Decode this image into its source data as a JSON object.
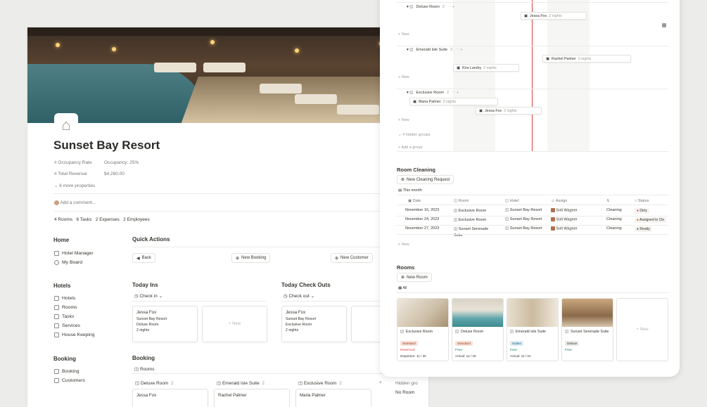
{
  "page": {
    "title": "Sunset Bay Resort",
    "icon": "house-flood-icon"
  },
  "properties": [
    {
      "label": "Occupancy Rate",
      "value": "Occupancy: 25%"
    },
    {
      "label": "Total Revenue",
      "value": "$4,280.00"
    }
  ],
  "more_properties": "6 more properties",
  "comment_placeholder": "Add a comment...",
  "relations": [
    "4 Rooms",
    "6 Tasks",
    "2 Expenses",
    "2 Employees"
  ],
  "sidebar": {
    "home": "Home",
    "home_items": [
      "Hotel Manager",
      "My Board"
    ],
    "hotels": "Hotels",
    "hotels_items": [
      "Hotels",
      "Rooms",
      "Tasks",
      "Services",
      "House Keeping"
    ],
    "booking": "Booking",
    "booking_items": [
      "Booking",
      "Customers"
    ]
  },
  "quick": {
    "title": "Quick Actions",
    "back": "Back",
    "new_booking": "New Booking",
    "new_customer": "New Customer"
  },
  "checkins": {
    "title": "Today Ins",
    "view": "Check in",
    "card": {
      "name": "Jessa Fox",
      "hotel": "Sunset Bay Resort",
      "room": "Deluxe Room",
      "nights": "2 nights"
    },
    "new": "New"
  },
  "checkouts": {
    "title": "Today Check Outs",
    "view": "Check out",
    "card": {
      "name": "Jessa Fox",
      "hotel": "Sunset Bay Resort",
      "room": "Exclusive Room",
      "nights": "2 nights"
    }
  },
  "booking": {
    "title": "Booking",
    "view": "Rooms",
    "cols": [
      {
        "name": "Deluxe Room",
        "count": "2",
        "first": "Jessa Fox"
      },
      {
        "name": "Emerald Isle Suite",
        "count": "2",
        "first": "Rachel Palmer"
      },
      {
        "name": "Exclusive Room",
        "count": "2",
        "first": "Maria Palmer"
      }
    ],
    "hidden": "Hidden gro",
    "noroom": "No Room"
  },
  "timeline": {
    "groups": [
      {
        "name": "Deluxe Room",
        "count": "2",
        "items": [
          {
            "name": "Jessa Fox",
            "nights": "2 nights"
          }
        ]
      },
      {
        "name": "Emerald Isle Suite",
        "count": "2",
        "items": [
          {
            "name": "Rachel Palmer",
            "nights": "3 nights"
          },
          {
            "name": "Kira Landry",
            "nights": "2 nights"
          }
        ]
      },
      {
        "name": "Exclusive Room",
        "count": "2",
        "items": [
          {
            "name": "Maria Palmer",
            "nights": "3 nights"
          },
          {
            "name": "Jessa Fox",
            "nights": "2 nights"
          }
        ]
      }
    ],
    "new": "New",
    "hidden_groups": "4 hidden groups",
    "add_group": "Add a group"
  },
  "cleaning": {
    "title": "Room Cleaning",
    "new_btn": "New Cleaning Request",
    "view": "This month",
    "headers": [
      "Date",
      "Room",
      "Hotel",
      "Assign",
      "",
      "Status"
    ],
    "rows": [
      {
        "date": "November 16, 2023",
        "room": "Exclusive Room",
        "hotel": "Sunset Bay Resort",
        "assign": "Solt Wagner",
        "type": "Cleaning",
        "status": "Dirty",
        "status_color": "#e03e3e"
      },
      {
        "date": "November 24, 2023",
        "room": "Exclusive Room",
        "hotel": "Sunset Bay Resort",
        "assign": "Solt Wagner",
        "type": "Cleaning",
        "status": "Assigned to Cle",
        "status_color": "#d9730d"
      },
      {
        "date": "November 27, 2023",
        "room": "Sunset Serenade Suite",
        "hotel": "Sunset Bay Resort",
        "assign": "Solt Wagner",
        "type": "Cleaning",
        "status": "Ready",
        "status_color": "#0f7b6c"
      }
    ],
    "new": "New"
  },
  "rooms": {
    "title": "Rooms",
    "new_btn": "New Room",
    "view": "All",
    "cards": [
      {
        "name": "Exclusive Room",
        "tag": "Standard",
        "status": "Reserved",
        "date": "Departure: 11 / 30"
      },
      {
        "name": "Deluxe Room",
        "tag": "Standard",
        "status": "Free",
        "date": "Arrival: 12 / 20"
      },
      {
        "name": "Emerald Isle Suite",
        "tag": "Suites",
        "status": "Free",
        "date": "Arrival: 12 / 01"
      },
      {
        "name": "Sunset Serenade Suite",
        "tag": "Deluxe",
        "status": "Free",
        "date": ""
      }
    ],
    "new": "New"
  }
}
